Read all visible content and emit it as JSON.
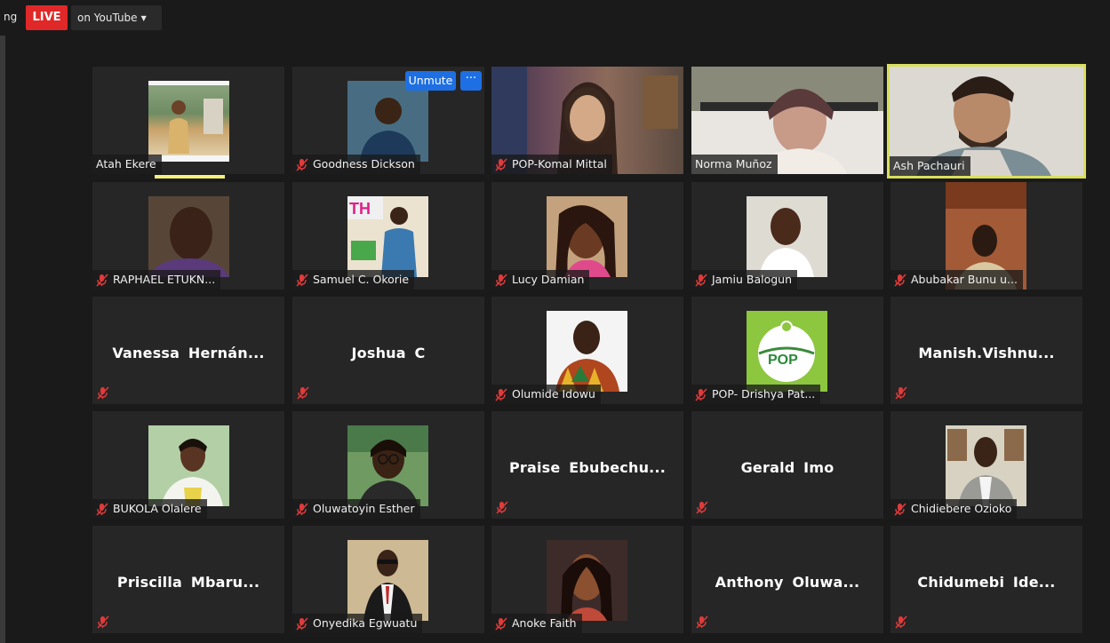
{
  "topbar": {
    "partial_text": "ng",
    "live_label": "LIVE",
    "youtube_label": "on YouTube",
    "live_color": "#e02828"
  },
  "tile_controls": {
    "unmute_label": "Unmute",
    "more_label": "···",
    "button_color": "#1e6fe3"
  },
  "active_speaker_color": "#d9df5b",
  "participants": [
    {
      "name": "Atah Ekere",
      "muted": false,
      "video": true
    },
    {
      "name": "Goodness Dickson",
      "muted": true,
      "video": true
    },
    {
      "name": "POP-Komal Mittal",
      "muted": true,
      "video": true
    },
    {
      "name": "Norma Muñoz",
      "muted": false,
      "video": true
    },
    {
      "name": "Ash Pachauri",
      "muted": false,
      "video": true,
      "speaking": true
    },
    {
      "name": "RAPHAEL ETUKN...",
      "muted": true,
      "video": true
    },
    {
      "name": "Samuel C. Okorie",
      "muted": true,
      "video": true
    },
    {
      "name": "Lucy Damian",
      "muted": true,
      "video": true
    },
    {
      "name": "Jamiu Balogun",
      "muted": true,
      "video": true
    },
    {
      "name": "Abubakar Bunu u...",
      "muted": true,
      "video": true
    },
    {
      "name": "Vanessa  Hernán...",
      "muted": true,
      "video": false
    },
    {
      "name": "Joshua C",
      "muted": true,
      "video": false
    },
    {
      "name": "Olumide Idowu",
      "muted": true,
      "video": true
    },
    {
      "name": "POP- Drishya Pat...",
      "muted": true,
      "video": true,
      "logo_text": "POP"
    },
    {
      "name": "Manish.Vishnu...",
      "muted": true,
      "video": false
    },
    {
      "name": "BUKOLA Olalere",
      "muted": true,
      "video": true
    },
    {
      "name": "Oluwatoyin Esther",
      "muted": true,
      "video": true
    },
    {
      "name": "Praise  Ebubechu...",
      "muted": true,
      "video": false
    },
    {
      "name": "Gerald Imo",
      "muted": true,
      "video": false
    },
    {
      "name": "Chidiebere Ozioko",
      "muted": true,
      "video": true
    },
    {
      "name": "Priscilla  Mbaru...",
      "muted": true,
      "video": false
    },
    {
      "name": "Onyedika Egwuatu",
      "muted": true,
      "video": true
    },
    {
      "name": "Anoke Faith",
      "muted": true,
      "video": true
    },
    {
      "name": "Anthony  Oluwa...",
      "muted": true,
      "video": false
    },
    {
      "name": "Chidumebi  Ide...",
      "muted": true,
      "video": false
    }
  ]
}
